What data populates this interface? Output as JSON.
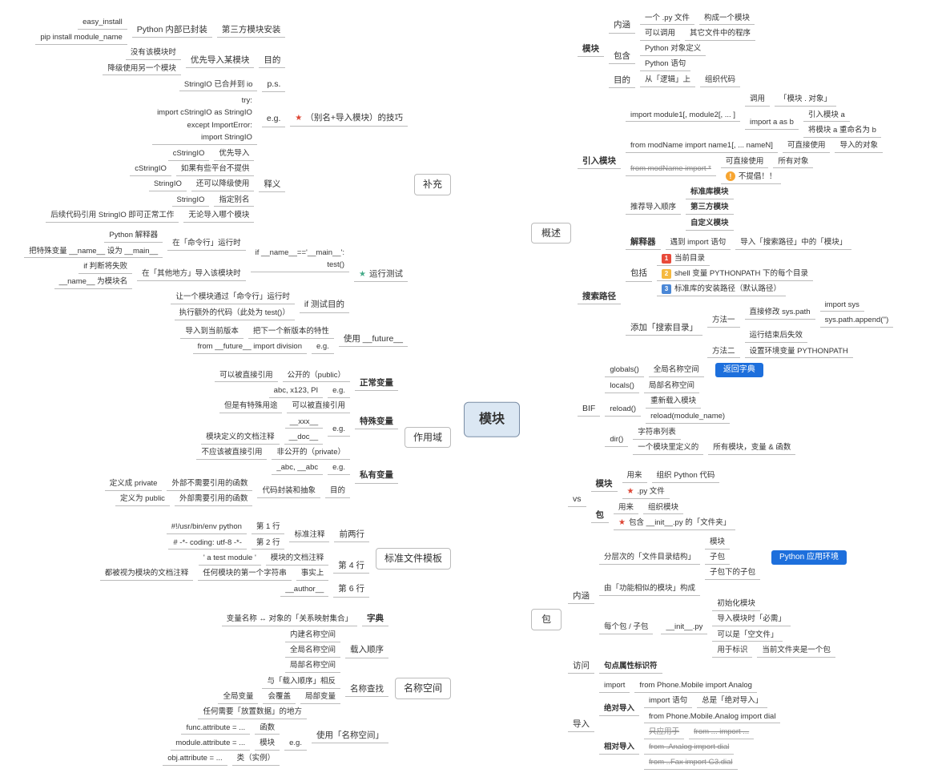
{
  "center": "模块",
  "left_branches": {
    "supplement": {
      "title": "补充",
      "trick": {
        "title": "（别名+导入模块）的技巧",
        "children": {
          "thirdparty_install": {
            "label": "第三方模块安装",
            "items": {
              "python_builtin": {
                "label": "Python 内部已封装",
                "items": [
                  "easy_install",
                  "pip install module_name"
                ]
              }
            }
          },
          "purpose": {
            "label": "目的",
            "pref_import": {
              "label": "优先导入某模块",
              "items": [
                "没有该模块时",
                "降级使用另一个模块"
              ]
            }
          },
          "ps": {
            "label": "p.s.",
            "item": "StringIO 已合并到 io"
          },
          "eg": {
            "label": "e.g.",
            "code": [
              "try:",
              "  import cStringIO as StringIO",
              "except ImportError:",
              "  import StringIO"
            ]
          },
          "shiyi": {
            "label": "释义",
            "items": [
              {
                "l": "优先导入",
                "r": "cStringIO"
              },
              {
                "l": "如果有些平台不提供",
                "r": "cStringIO"
              },
              {
                "l": "还可以降级使用",
                "r": "StringIO"
              },
              {
                "l": "指定别名",
                "r": "StringIO"
              },
              {
                "l": "无论导入哪个模块",
                "r": "后续代码引用 StringIO 即可正常工作"
              }
            ]
          }
        }
      },
      "run_test": {
        "title": "运行测试",
        "children": {
          "if_main": {
            "label": "if __name__=='__main__':",
            "code": "  test()",
            "details": [
              {
                "l": "在「命令行」运行时",
                "sub": [
                  {
                    "l": "Python 解释器"
                  },
                  {
                    "l": "把特殊变量 __name__ 设为 __main__"
                  }
                ]
              },
              {
                "l": "在「其他地方」导入该模块时",
                "sub": [
                  {
                    "l": "if 判断将失败"
                  },
                  {
                    "l": "__name__ 为模块名"
                  }
                ]
              }
            ]
          },
          "test_purpose": {
            "label": "if 测试目的",
            "items": [
              "让一个模块通过「命令行」运行时",
              "执行额外的代码（此处为 test()）"
            ]
          }
        }
      },
      "future": {
        "label": "使用 __future__",
        "items": [
          {
            "l": "把下一个新版本的特性",
            "r": "导入到当前版本"
          },
          {
            "l": "e.g.",
            "r": "from __future__ import division"
          }
        ]
      }
    },
    "scope": {
      "title": "作用域",
      "normal": {
        "label": "正常变量",
        "items": [
          {
            "l": "公开的（public）",
            "r": "可以被直接引用"
          },
          {
            "l": "e.g.",
            "r": "abc, x123, PI"
          }
        ]
      },
      "special": {
        "label": "特殊变量",
        "items": [
          {
            "l": "可以被直接引用",
            "r": "但是有特殊用途"
          },
          {
            "l": "e.g.",
            "items": [
              "__xxx__",
              "__doc__"
            ],
            "note": "模块定义的文档注释"
          }
        ]
      },
      "private": {
        "label": "私有变量",
        "items": [
          {
            "l": "非公开的（private）",
            "r": "不应该被直接引用"
          },
          {
            "l": "e.g.",
            "r": "_abc, __abc"
          },
          {
            "l": "目的",
            "r": "代码封装和抽象",
            "sub": [
              {
                "l": "外部不需要引用的函数",
                "r": "定义成 private"
              },
              {
                "l": "外部需要引用的函数",
                "r": "定义为 public"
              }
            ]
          }
        ]
      }
    },
    "std_tpl": {
      "title": "标准文件模板",
      "qianliangh": {
        "label": "前两行",
        "sub": "标准注释",
        "items": [
          {
            "l": "第 1 行",
            "r": "#!/usr/bin/env python"
          },
          {
            "l": "第 2 行",
            "r": "# -*- coding: utf-8 -*-"
          }
        ]
      },
      "line4": {
        "label": "第 4 行",
        "items": [
          {
            "l": "模块的文档注释",
            "r": "' a test module '"
          },
          {
            "l": "事实上",
            "r": "任何模块的第一个字符串",
            "note": "都被视为模块的文档注释"
          }
        ]
      },
      "line6": {
        "label": "第 6 行",
        "r": "__author__"
      }
    },
    "namespace": {
      "title": "名称空间",
      "dict": {
        "label": "字典",
        "r": "变量名称 ↔ 对象的「关系映射集合」"
      },
      "load_order": {
        "label": "载入顺序",
        "items": [
          "内建名称空间",
          "全局名称空间",
          "局部名称空间"
        ]
      },
      "lookup": {
        "label": "名称查找",
        "r": "与「载入顺序」相反",
        "sub": {
          "l": "局部变量",
          "r": "会覆盖",
          "r2": "全局变量"
        }
      },
      "use": {
        "label": "使用「名称空间」",
        "r": "任何需要「放置数据」的地方",
        "eg_label": "e.g.",
        "items": [
          {
            "l": "函数",
            "r": "func.attribute = ..."
          },
          {
            "l": "模块",
            "r": "module.attribute = ..."
          },
          {
            "l": "类（实例）",
            "r": "obj.attribute = ..."
          }
        ]
      }
    }
  },
  "right_branches": {
    "overview": {
      "title": "概述",
      "module": {
        "label": "模块",
        "connotation": {
          "label": "内涵",
          "items": [
            {
              "l": "一个 .py 文件",
              "r": "构成一个模块"
            },
            {
              "l": "可以调用",
              "r": "其它文件中的程序"
            }
          ]
        },
        "contains": {
          "label": "包含",
          "items": [
            "Python 对象定义",
            "Python 语句"
          ]
        },
        "purpose": {
          "label": "目的",
          "l": "从「逻辑」上",
          "r": "组织代码"
        }
      },
      "import": {
        "label": "引入模块",
        "items": [
          {
            "l": "import module1[, module2[, ... ]",
            "sub": [
              {
                "l": "调用",
                "r": "「模块 . 对象」"
              },
              {
                "l": "import a as b",
                "sub": [
                  "引入模块 a",
                  "将模块 a 重命名为 b"
                ]
              }
            ]
          },
          {
            "l": "from modName import name1[, ... nameN]",
            "r": "可直接使用",
            "r2": "导入的对象"
          },
          {
            "l": "from modName import *",
            "strike": true,
            "sub": [
              {
                "l": "可直接使用",
                "r": "所有对象"
              },
              {
                "warn": true,
                "l": "不提倡！！"
              }
            ]
          },
          {
            "l": "推荐导入顺序",
            "items_bold": [
              "标准库模块",
              "第三方模块",
              "自定义模块"
            ]
          }
        ]
      },
      "search": {
        "label": "搜索路径",
        "interp": {
          "label": "解释器",
          "l": "遇到 import 语句",
          "r": "导入「搜索路径」中的「模块」"
        },
        "includes": {
          "label": "包括",
          "items": [
            {
              "n": 1,
              "t": "当前目录"
            },
            {
              "n": 2,
              "t": "shell 变量 PYTHONPATH 下的每个目录"
            },
            {
              "n": 3,
              "t": "标准库的安装路径（默认路径）"
            }
          ]
        },
        "add": {
          "label": "添加「搜索目录」",
          "items": [
            {
              "l": "方法一",
              "sub": [
                {
                  "l": "直接修改 sys.path",
                  "code": [
                    "import sys",
                    "sys.path.append('')"
                  ]
                },
                {
                  "l": "运行结束后失效"
                }
              ]
            },
            {
              "l": "方法二",
              "r": "设置环境变量 PYTHONPATH"
            }
          ]
        }
      },
      "bif": {
        "label": "BIF",
        "items": [
          {
            "l": "globals()",
            "r": "全局名称空间",
            "pill": "返回字典"
          },
          {
            "l": "locals()",
            "r": "局部名称空间",
            "pill_shared": true
          },
          {
            "l": "reload()",
            "sub": [
              "重新载入模块",
              "reload(module_name)"
            ]
          },
          {
            "l": "dir()",
            "sub": [
              {
                "l": "字符串列表"
              },
              {
                "l": "一个模块里定义的",
                "r": "所有模块，变量 & 函数"
              }
            ]
          }
        ]
      }
    },
    "package": {
      "title": "包",
      "vs": {
        "label": "vs",
        "items": [
          {
            "l": "模块",
            "sub": [
              {
                "l": "用来",
                "r": "组织 Python 代码"
              },
              {
                "star": true,
                "l": ".py 文件"
              }
            ]
          },
          {
            "l": "包",
            "sub": [
              {
                "l": "用来",
                "r": "组织模块"
              },
              {
                "star": true,
                "l": "包含 __init__.py 的「文件夹」"
              }
            ]
          }
        ]
      },
      "connotation": {
        "label": "内涵",
        "items": [
          {
            "l": "分层次的「文件目录结构」",
            "sub": [
              "模块",
              "子包",
              "子包下的子包"
            ],
            "pill": "Python 应用环境"
          },
          {
            "l": "由「功能相似的模块」构成"
          },
          {
            "l": "每个包 / 子包",
            "r": "__init__.py",
            "sub": [
              "初始化模块",
              {
                "l": "导入模块时「必需」"
              },
              {
                "l": "可以是「空文件」"
              },
              {
                "l": "用于标识",
                "r": "当前文件夹是一个包"
              }
            ]
          }
        ]
      },
      "access": {
        "label": "访问",
        "r": "句点属性标识符"
      },
      "import": {
        "label": "导入",
        "items": [
          {
            "l": "import",
            "r": "from Phone.Mobile import Analog"
          },
          {
            "l": "绝对导入",
            "sub": [
              {
                "l": "import 语句",
                "r": "总是「绝对导入」"
              },
              {
                "l": "from Phone.Mobile.Analog import dial"
              }
            ]
          },
          {
            "l": "相对导入",
            "sub": [
              {
                "l": "只应用于",
                "r": "from ... import ...",
                "strike_r": true,
                "strike_l": true
              },
              {
                "l": "from .Analog import dial",
                "strike": true
              },
              {
                "l": "from ..Fax import G3.dial",
                "strike": true
              }
            ]
          }
        ]
      }
    }
  }
}
